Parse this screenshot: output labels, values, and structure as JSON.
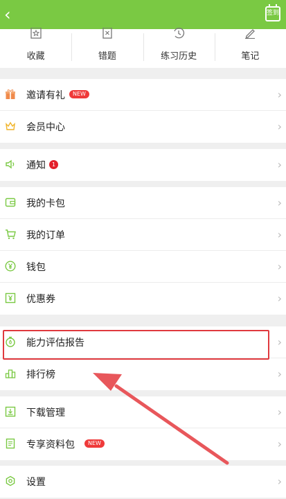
{
  "header": {
    "back_icon": "chevron-left-icon",
    "calendar_label": "签到"
  },
  "quick_actions": [
    {
      "label": "收藏",
      "icon": "star-icon"
    },
    {
      "label": "错题",
      "icon": "wrong-icon"
    },
    {
      "label": "练习历史",
      "icon": "history-icon"
    },
    {
      "label": "笔记",
      "icon": "pen-icon"
    }
  ],
  "menu": {
    "invite": {
      "label": "邀请有礼",
      "badge": "NEW"
    },
    "vip": {
      "label": "会员中心"
    },
    "notice": {
      "label": "通知",
      "count": "1"
    },
    "card": {
      "label": "我的卡包"
    },
    "order": {
      "label": "我的订单"
    },
    "wallet": {
      "label": "钱包"
    },
    "coupon": {
      "label": "优惠券"
    },
    "report": {
      "label": "能力评估报告"
    },
    "rank": {
      "label": "排行榜"
    },
    "download": {
      "label": "下载管理"
    },
    "exclusive": {
      "label": "专享资料包",
      "badge": "NEW"
    },
    "settings": {
      "label": "设置"
    }
  },
  "colors": {
    "brand_green": "#7ac943",
    "highlight_red": "#e0393e",
    "badge_red": "#ef3a3a"
  }
}
